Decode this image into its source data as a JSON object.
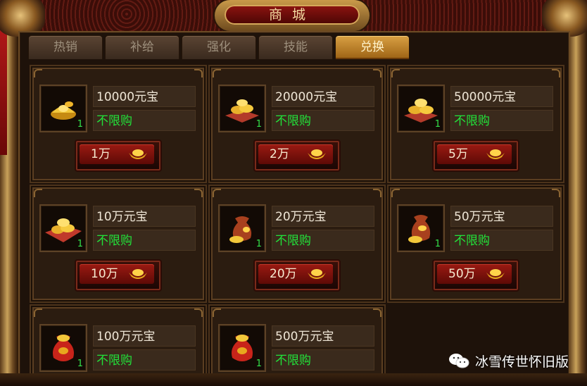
{
  "window": {
    "title": "商城"
  },
  "tabs": [
    {
      "label": "热销",
      "active": false
    },
    {
      "label": "补给",
      "active": false
    },
    {
      "label": "强化",
      "active": false
    },
    {
      "label": "技能",
      "active": false
    },
    {
      "label": "兑换",
      "active": true
    }
  ],
  "items": [
    {
      "name": "10000元宝",
      "limit": "不限购",
      "qty": "1",
      "price": "1万",
      "icon": "gold-ingot-small-icon"
    },
    {
      "name": "20000元宝",
      "limit": "不限购",
      "qty": "1",
      "price": "2万",
      "icon": "gold-ingot-pile-icon"
    },
    {
      "name": "50000元宝",
      "limit": "不限购",
      "qty": "1",
      "price": "5万",
      "icon": "gold-ingot-pile-icon"
    },
    {
      "name": "10万元宝",
      "limit": "不限购",
      "qty": "1",
      "price": "10万",
      "icon": "gold-ingot-cloth-icon"
    },
    {
      "name": "20万元宝",
      "limit": "不限购",
      "qty": "1",
      "price": "20万",
      "icon": "money-bag-icon"
    },
    {
      "name": "50万元宝",
      "limit": "不限购",
      "qty": "1",
      "price": "50万",
      "icon": "money-bag-icon"
    },
    {
      "name": "100万元宝",
      "limit": "不限购",
      "qty": "1",
      "price": "",
      "icon": "red-money-bag-icon"
    },
    {
      "name": "500万元宝",
      "limit": "不限购",
      "qty": "1",
      "price": "",
      "icon": "red-money-bag-icon"
    }
  ],
  "watermark": {
    "text": "冰雪传世怀旧版",
    "icon": "wechat-icon"
  },
  "colors": {
    "limit_text": "#22e23a",
    "qty_text": "#33e14a",
    "active_tab": "#d9a043",
    "button_red": "#9a1a12"
  }
}
